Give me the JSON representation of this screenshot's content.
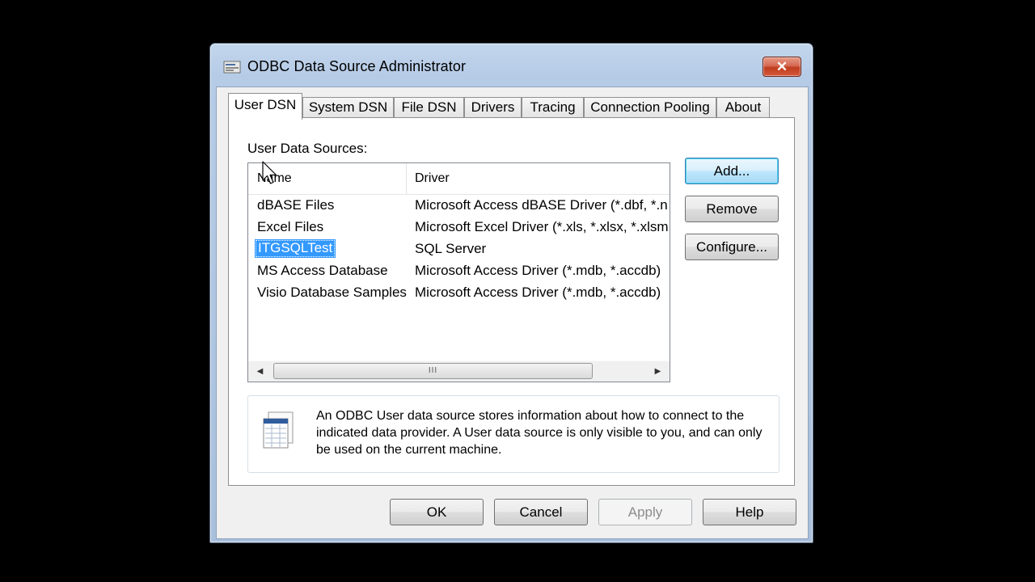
{
  "window": {
    "title": "ODBC Data Source Administrator",
    "close_symbol": "✕",
    "title_icon": "odbc-admin-icon"
  },
  "tabs": [
    {
      "label": "User DSN",
      "active": true
    },
    {
      "label": "System DSN",
      "active": false
    },
    {
      "label": "File DSN",
      "active": false
    },
    {
      "label": "Drivers",
      "active": false
    },
    {
      "label": "Tracing",
      "active": false
    },
    {
      "label": "Connection Pooling",
      "active": false
    },
    {
      "label": "About",
      "active": false
    }
  ],
  "panel": {
    "section_label": "User Data Sources:",
    "columns": [
      "Name",
      "Driver"
    ],
    "rows": [
      {
        "name": "dBASE Files",
        "driver": "Microsoft Access dBASE Driver (*.dbf, *.ndx, *.mdx)"
      },
      {
        "name": "Excel Files",
        "driver": "Microsoft Excel Driver (*.xls, *.xlsx, *.xlsm, *.xlsb)"
      },
      {
        "name": "ITGSQLTest",
        "driver": "SQL Server",
        "selected": true
      },
      {
        "name": "MS Access Database",
        "driver": "Microsoft Access Driver (*.mdb, *.accdb)"
      },
      {
        "name": "Visio Database Samples",
        "driver": "Microsoft Access Driver (*.mdb, *.accdb)"
      }
    ],
    "scroll_thumb_grip": "III",
    "side_buttons": {
      "add": "Add...",
      "remove": "Remove",
      "configure": "Configure..."
    },
    "info_text": "An ODBC User data source stores information about how to connect to the indicated data provider.   A User data source is only visible to you, and can only be used on the current machine."
  },
  "bottom_buttons": {
    "ok": "OK",
    "cancel": "Cancel",
    "apply": "Apply",
    "help": "Help"
  },
  "colors": {
    "selection": "#3399ff",
    "window_frame": "#b6cbe6",
    "close_button": "#c03d1f"
  }
}
